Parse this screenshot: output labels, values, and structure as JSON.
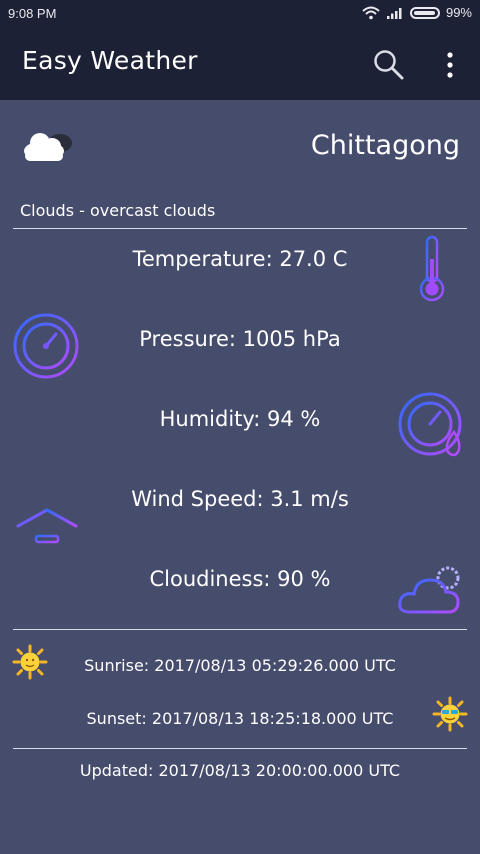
{
  "status_bar": {
    "time": "9:08 PM",
    "battery": "99%"
  },
  "app_bar": {
    "title": "Easy Weather",
    "search_icon": "search-icon",
    "overflow_icon": "more-vert-icon"
  },
  "weather": {
    "city": "Chittagong",
    "condition": "Clouds - overcast clouds",
    "temperature": "Temperature: 27.0 C",
    "pressure": "Pressure: 1005 hPa",
    "humidity": "Humidity: 94 %",
    "wind_speed": "Wind Speed: 3.1 m/s",
    "cloudiness": "Cloudiness: 90 %"
  },
  "sun": {
    "sunrise": "Sunrise: 2017/08/13 05:29:26.000 UTC",
    "sunset": "Sunset: 2017/08/13 18:25:18.000 UTC"
  },
  "updated": "Updated: 2017/08/13 20:00:00.000 UTC",
  "colors": {
    "background": "#464c6c",
    "app_bar": "#1d2135",
    "icon_gradient_start": "#2f6bff",
    "icon_gradient_end": "#b24bff"
  }
}
